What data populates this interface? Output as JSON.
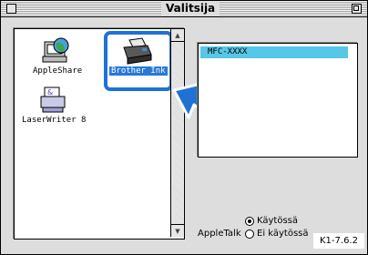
{
  "window": {
    "title": "Valitsija"
  },
  "left_panel": {
    "items": [
      {
        "label": "AppleShare",
        "icon": "appleshare-globe-icon",
        "selected": false
      },
      {
        "label": "Brother Ink",
        "icon": "inkjet-printer-icon",
        "selected": true
      },
      {
        "label": "LaserWriter 8",
        "icon": "laserwriter-icon",
        "selected": false
      }
    ]
  },
  "right_panel": {
    "items": [
      {
        "label": "MFC-XXXX",
        "selected": true
      }
    ]
  },
  "appletalk": {
    "label": "AppleTalk",
    "options": [
      {
        "label": "Käytössä",
        "checked": true
      },
      {
        "label": "Ei käytössä",
        "checked": false
      }
    ]
  },
  "version": "K1-7.6.2",
  "colors": {
    "highlight": "#1e72d6",
    "selection": "#2878d8",
    "list_selection": "#56c7e8"
  }
}
